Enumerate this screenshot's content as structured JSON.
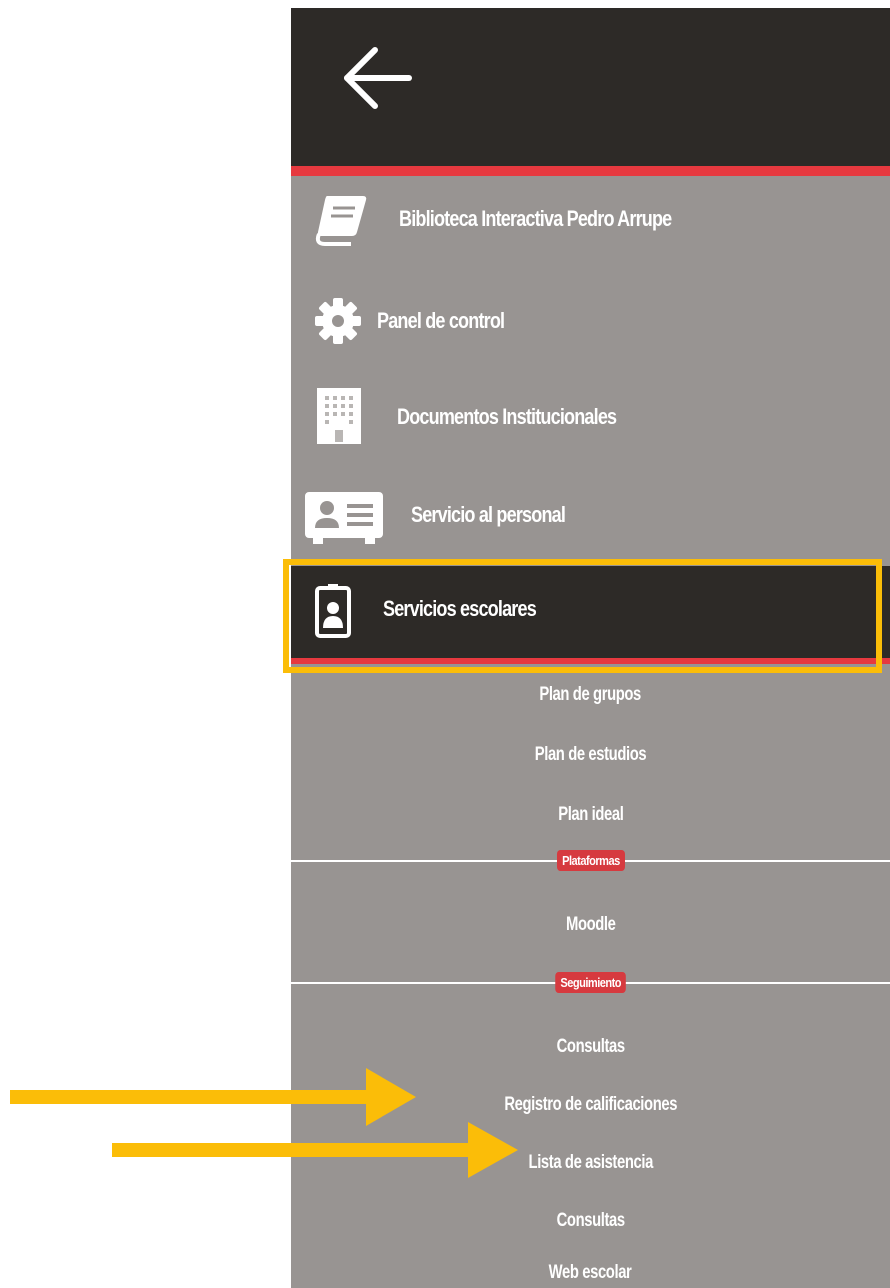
{
  "header": {
    "back_icon": "arrow-left-icon"
  },
  "menu": {
    "items": [
      {
        "label": "Biblioteca Interactiva Pedro Arrupe",
        "icon": "book-icon"
      },
      {
        "label": "Panel de control",
        "icon": "gear-icon"
      },
      {
        "label": "Documentos Institucionales",
        "icon": "building-icon"
      },
      {
        "label": "Servicio al personal",
        "icon": "id-card-icon"
      },
      {
        "label": "Servicios escolares",
        "icon": "badge-icon",
        "active": true
      }
    ]
  },
  "submenu": {
    "links_a": [
      "Plan de grupos",
      "Plan de estudios",
      "Plan ideal"
    ],
    "section_platforms": "Plataformas",
    "links_b": [
      "Moodle"
    ],
    "section_tracking": "Seguimiento",
    "links_c": [
      "Consultas",
      "Registro de calificaciones",
      "Lista de asistencia",
      "Consultas",
      "Web escolar"
    ]
  },
  "colors": {
    "panel_bg": "#989492",
    "dark": "#2d2a27",
    "accent_red": "#e6393f",
    "badge_red": "#d63a3f",
    "highlight_yellow": "#fbbd08",
    "arrow_yellow": "#fbbd08"
  }
}
